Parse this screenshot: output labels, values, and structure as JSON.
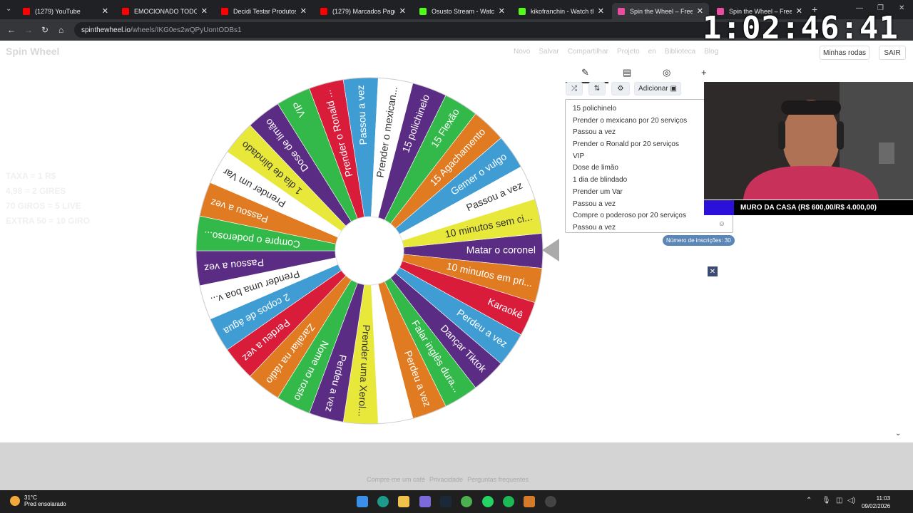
{
  "browser": {
    "tabs": [
      {
        "title": "(1279) YouTube",
        "color": "#ff0000",
        "active": false
      },
      {
        "title": "EMOCIONADO TODO ER...",
        "color": "#ff0000",
        "active": false
      },
      {
        "title": "Decidi Testar Produtos da...",
        "color": "#ff0000",
        "active": false
      },
      {
        "title": "(1279) Marcados Pagode...",
        "color": "#ff0000",
        "active": false
      },
      {
        "title": "Osusto Stream - Watch Li...",
        "color": "#53fc18",
        "active": false
      },
      {
        "title": "kikofranchin - Watch the...",
        "color": "#53fc18",
        "active": false
      },
      {
        "title": "Spin the Wheel – Free W...",
        "color": "#e94ca0",
        "active": true
      },
      {
        "title": "Spin the Wheel – Free W...",
        "color": "#e94ca0",
        "active": false
      }
    ],
    "url_domain": "spinthewheel.io",
    "url_path": "/wheels/IKG0es2wQPyUontODBs1"
  },
  "overlay": {
    "timer": "1:02:46:41",
    "banner_text": "MURO DA CASA (R$ 600,00/R$ 4.000,00)"
  },
  "site": {
    "logo": "Spin Wheel",
    "nav": [
      "Novo",
      "Salvar",
      "Compartilhar",
      "Projeto",
      "en",
      "Biblioteca",
      "Blog"
    ],
    "my_wheels": "Minhas rodas",
    "logout": "SAIR",
    "faded_lines": [
      "TAXA = 1 R$",
      "4,98 = 2 GIRES",
      "70 GIROS = 5 LIVE",
      "EXTRA 50 = 10 GIRO"
    ]
  },
  "editor": {
    "add_label": "Adicionar",
    "entries": [
      "15 polichinelo",
      "Prender o mexicano por 20 serviços",
      "Passou a vez",
      "Prender o Ronald por 20 serviços",
      "VIP",
      "Dose de limão",
      "1 dia de blindado",
      "Prender um Var",
      "Passou a vez",
      "Compre o poderoso por 20 serviços",
      "Passou a vez"
    ],
    "count_label": "Número de inscrições: 30"
  },
  "wheel": {
    "segments": [
      {
        "label": "Matar o coronel",
        "color": "#5b2c83"
      },
      {
        "label": "10 minutos em pri...",
        "color": "#e07b21"
      },
      {
        "label": "Karaokê",
        "color": "#d81c3a"
      },
      {
        "label": "Perdeu a vez",
        "color": "#3f9dd3"
      },
      {
        "label": "Dançar Tiktok",
        "color": "#5b2c83"
      },
      {
        "label": "Falar inglês dura...",
        "color": "#33b94a"
      },
      {
        "label": "Perdeu a vez",
        "color": "#e07b21"
      },
      {
        "label": "",
        "color": "#ffffff"
      },
      {
        "label": "Prender uma Xerol...",
        "color": "#e8e83a"
      },
      {
        "label": "Perdeu a vez",
        "color": "#5b2c83"
      },
      {
        "label": "Nome no rosto",
        "color": "#33b94a"
      },
      {
        "label": "Zaraliar na rádio",
        "color": "#e07b21"
      },
      {
        "label": "Perdeu a vez",
        "color": "#d81c3a"
      },
      {
        "label": "2 copos de água",
        "color": "#3f9dd3"
      },
      {
        "label": "Prender uma boa v...",
        "color": "#ffffff"
      },
      {
        "label": "Passou a vez",
        "color": "#5b2c83"
      },
      {
        "label": "Compre o poderoso...",
        "color": "#33b94a"
      },
      {
        "label": "Passou a vez",
        "color": "#e07b21"
      },
      {
        "label": "Prender um Var",
        "color": "#ffffff"
      },
      {
        "label": "1 dia de blindado",
        "color": "#e8e83a"
      },
      {
        "label": "Dose de limão",
        "color": "#5b2c83"
      },
      {
        "label": "VIP",
        "color": "#33b94a"
      },
      {
        "label": "Prender o Ronald ...",
        "color": "#d81c3a"
      },
      {
        "label": "Passou a vez",
        "color": "#3f9dd3"
      },
      {
        "label": "Prender o mexican...",
        "color": "#ffffff"
      },
      {
        "label": "15 polichinelo",
        "color": "#5b2c83"
      },
      {
        "label": "15 Flexão",
        "color": "#33b94a"
      },
      {
        "label": "15 Agachamento",
        "color": "#e07b21"
      },
      {
        "label": "Gemer o vulgo",
        "color": "#3f9dd3"
      },
      {
        "label": "Passou a vez",
        "color": "#ffffff"
      },
      {
        "label": "10 minutos sem ci...",
        "color": "#e8e83a"
      }
    ]
  },
  "footer": {
    "links": [
      "Compre-me um café",
      "Privacidade",
      "Perguntas frequentes"
    ]
  },
  "taskbar": {
    "weather_temp": "31°C",
    "weather_desc": "Pred ensolarado",
    "time": "11:03",
    "date": "09/02/2026"
  }
}
